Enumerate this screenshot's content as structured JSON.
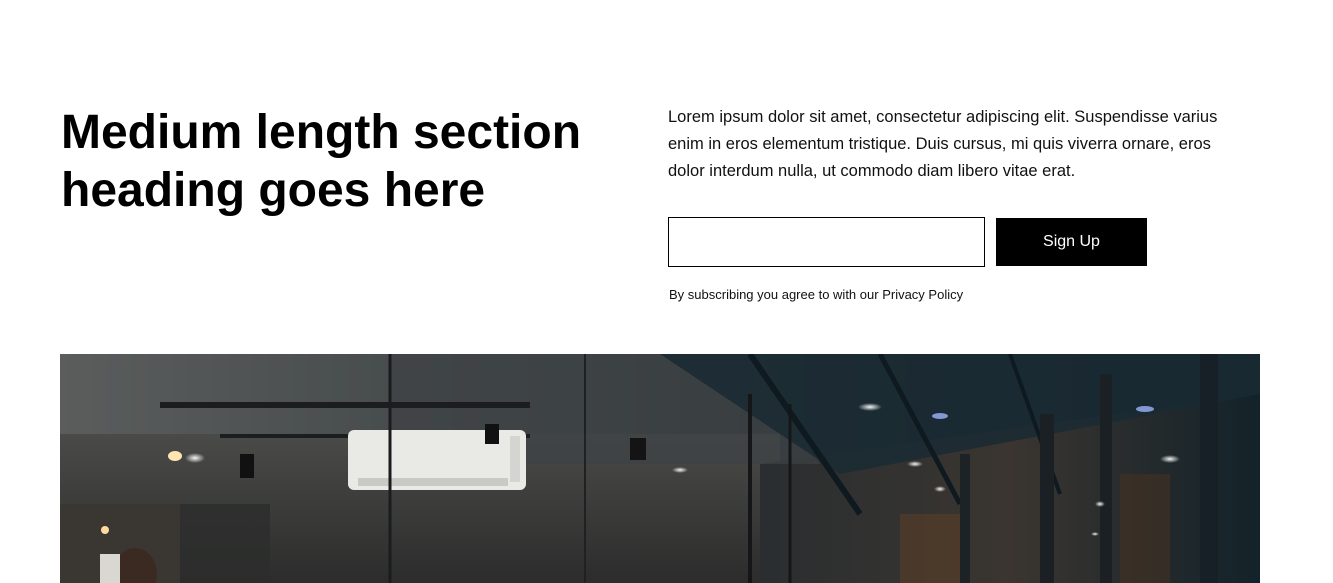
{
  "header": {
    "heading": "Medium length section heading goes here"
  },
  "intro": {
    "body": "Lorem ipsum dolor sit amet, consectetur adipiscing elit. Suspendisse varius enim in eros elementum tristique. Duis cursus, mi quis viverra ornare, eros dolor interdum nulla, ut commodo diam libero vitae erat."
  },
  "signup": {
    "email_value": "",
    "email_placeholder": "",
    "button_label": "Sign Up",
    "disclaimer_prefix": "By subscribing you agree to with our",
    "privacy_link": "Privacy Policy"
  },
  "colors": {
    "accent": "#000000",
    "background": "#ffffff"
  }
}
